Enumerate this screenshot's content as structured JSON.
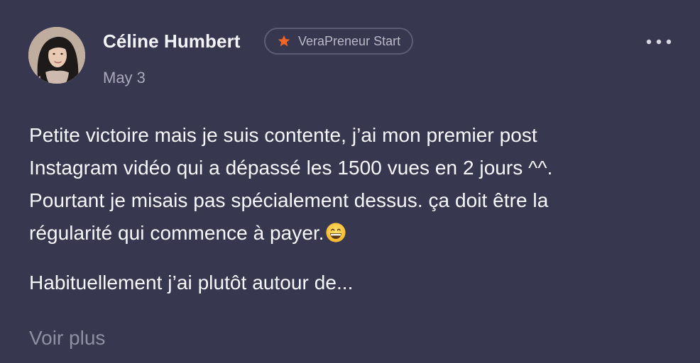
{
  "post": {
    "author": {
      "name": "Céline Humbert",
      "badge": {
        "label": "VeraPreneur Start",
        "icon": "star-icon",
        "icon_color": "#f26422"
      }
    },
    "date": "May 3",
    "menu_icon": "more-horizontal-icon",
    "body": {
      "paragraph_1_lines": [
        "Petite victoire mais je suis contente, j’ai mon premier post",
        "Instagram vidéo qui a dépassé les 1500 vues en 2 jours ^^.",
        "Pourtant je misais pas spécialement dessus. ça doit être la",
        "régularité qui commence à payer."
      ],
      "paragraph_1_emoji": "grinning-face-emoji",
      "paragraph_2": "Habituellement j’ai plutôt autour de..."
    },
    "see_more_label": "Voir plus"
  },
  "colors": {
    "background": "#373750",
    "text_primary": "#f7f7fb",
    "text_secondary": "#a9a9ba",
    "text_muted": "#8f8fa3",
    "badge_border": "#5c5c72",
    "accent": "#f26422"
  }
}
